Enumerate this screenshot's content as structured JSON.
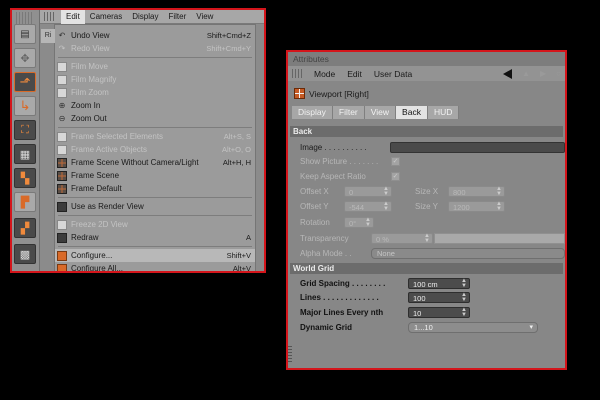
{
  "colors": {
    "highlight_border": "#d4151b",
    "panel_bg": "#8b8b8b",
    "menu_bg": "#9b9b9b",
    "active_tab_bg": "#e3e3e3",
    "section_header_bg": "#6c6c6c",
    "field_dark_bg": "#4c4c4c"
  },
  "left": {
    "menubar": [
      {
        "label": "Edit",
        "active": true
      },
      {
        "label": "Cameras"
      },
      {
        "label": "Display"
      },
      {
        "label": "Filter"
      },
      {
        "label": "View"
      }
    ],
    "dropdown_edge_label": "Ri",
    "menu_items": [
      {
        "label": "Undo View",
        "shortcut": "Shift+Cmd+Z",
        "icon": "undo-view-icon",
        "disabled": false
      },
      {
        "label": "Redo View",
        "shortcut": "Shift+Cmd+Y",
        "icon": "redo-view-icon",
        "disabled": true
      },
      {
        "label": "Film Move",
        "shortcut": "",
        "icon": "film-move-icon",
        "disabled": true
      },
      {
        "label": "Film Magnify",
        "shortcut": "",
        "icon": "film-magnify-icon",
        "disabled": true
      },
      {
        "label": "Film Zoom",
        "shortcut": "",
        "icon": "film-zoom-icon",
        "disabled": true
      },
      {
        "label": "Zoom In",
        "shortcut": "",
        "icon": "zoom-in-icon",
        "disabled": false
      },
      {
        "label": "Zoom Out",
        "shortcut": "",
        "icon": "zoom-out-icon",
        "disabled": false
      },
      {
        "label": "Frame Selected Elements",
        "shortcut": "Alt+S, S",
        "icon": "frame-selected-icon",
        "disabled": true
      },
      {
        "label": "Frame Active Objects",
        "shortcut": "Alt+O, O",
        "icon": "frame-active-icon",
        "disabled": true
      },
      {
        "label": "Frame Scene Without Camera/Light",
        "shortcut": "Alt+H, H",
        "icon": "frame-scene-nocam-icon",
        "disabled": false
      },
      {
        "label": "Frame Scene",
        "shortcut": "",
        "icon": "frame-scene-icon",
        "disabled": false
      },
      {
        "label": "Frame Default",
        "shortcut": "",
        "icon": "frame-default-icon",
        "disabled": false
      },
      {
        "label": "Use as Render View",
        "shortcut": "",
        "icon": "render-view-icon",
        "disabled": false
      },
      {
        "label": "Freeze 2D View",
        "shortcut": "",
        "icon": "freeze-view-icon",
        "disabled": true
      },
      {
        "label": "Redraw",
        "shortcut": "A",
        "icon": "redraw-icon",
        "disabled": false
      },
      {
        "label": "Configure...",
        "shortcut": "Shift+V",
        "icon": "configure-icon",
        "disabled": false,
        "highlighted": true
      },
      {
        "label": "Configure All...",
        "shortcut": "Alt+V",
        "icon": "configure-all-icon",
        "disabled": false
      }
    ],
    "toolbar_icons": [
      "viewport-tool-icon",
      "move-icon",
      "rotate-icon",
      "axis-icon",
      "polygon-icon",
      "grid-icon",
      "points-icon",
      "edges-icon",
      "texture-icon",
      "checker-icon",
      "checker-alt-icon"
    ]
  },
  "right": {
    "title": "Attributes",
    "menubar": [
      "Mode",
      "Edit",
      "User Data"
    ],
    "object_label": "Viewport [Right]",
    "tabs": [
      {
        "label": "Display",
        "active": false
      },
      {
        "label": "Filter",
        "active": false
      },
      {
        "label": "View",
        "active": false
      },
      {
        "label": "Back",
        "active": true
      },
      {
        "label": "HUD",
        "active": false
      }
    ],
    "back_section": {
      "title": "Back",
      "image_label": "Image . . . . . . . . . .",
      "show_picture_label": "Show Picture . . . . . . .",
      "keep_aspect_label": "Keep Aspect Ratio",
      "offset_x_label": "Offset X",
      "offset_x_value": "0",
      "size_x_label": "Size X",
      "size_x_value": "800",
      "offset_y_label": "Offset Y",
      "offset_y_value": "-544",
      "size_y_label": "Size Y",
      "size_y_value": "1200",
      "rotation_label": "Rotation",
      "rotation_value": "0°",
      "transparency_label": "Transparency",
      "transparency_value": "0 %",
      "alpha_mode_label": "Alpha Mode . .",
      "alpha_mode_value": "None"
    },
    "world_grid": {
      "title": "World Grid",
      "grid_spacing_label": "Grid Spacing . . . . . . . .",
      "grid_spacing_value": "100 cm",
      "lines_label": "Lines . . . . . . . . . . . . .",
      "lines_value": "100",
      "major_lines_label": "Major Lines Every nth",
      "major_lines_value": "10",
      "dynamic_grid_label": "Dynamic Grid",
      "dynamic_grid_value": "1...10"
    }
  }
}
